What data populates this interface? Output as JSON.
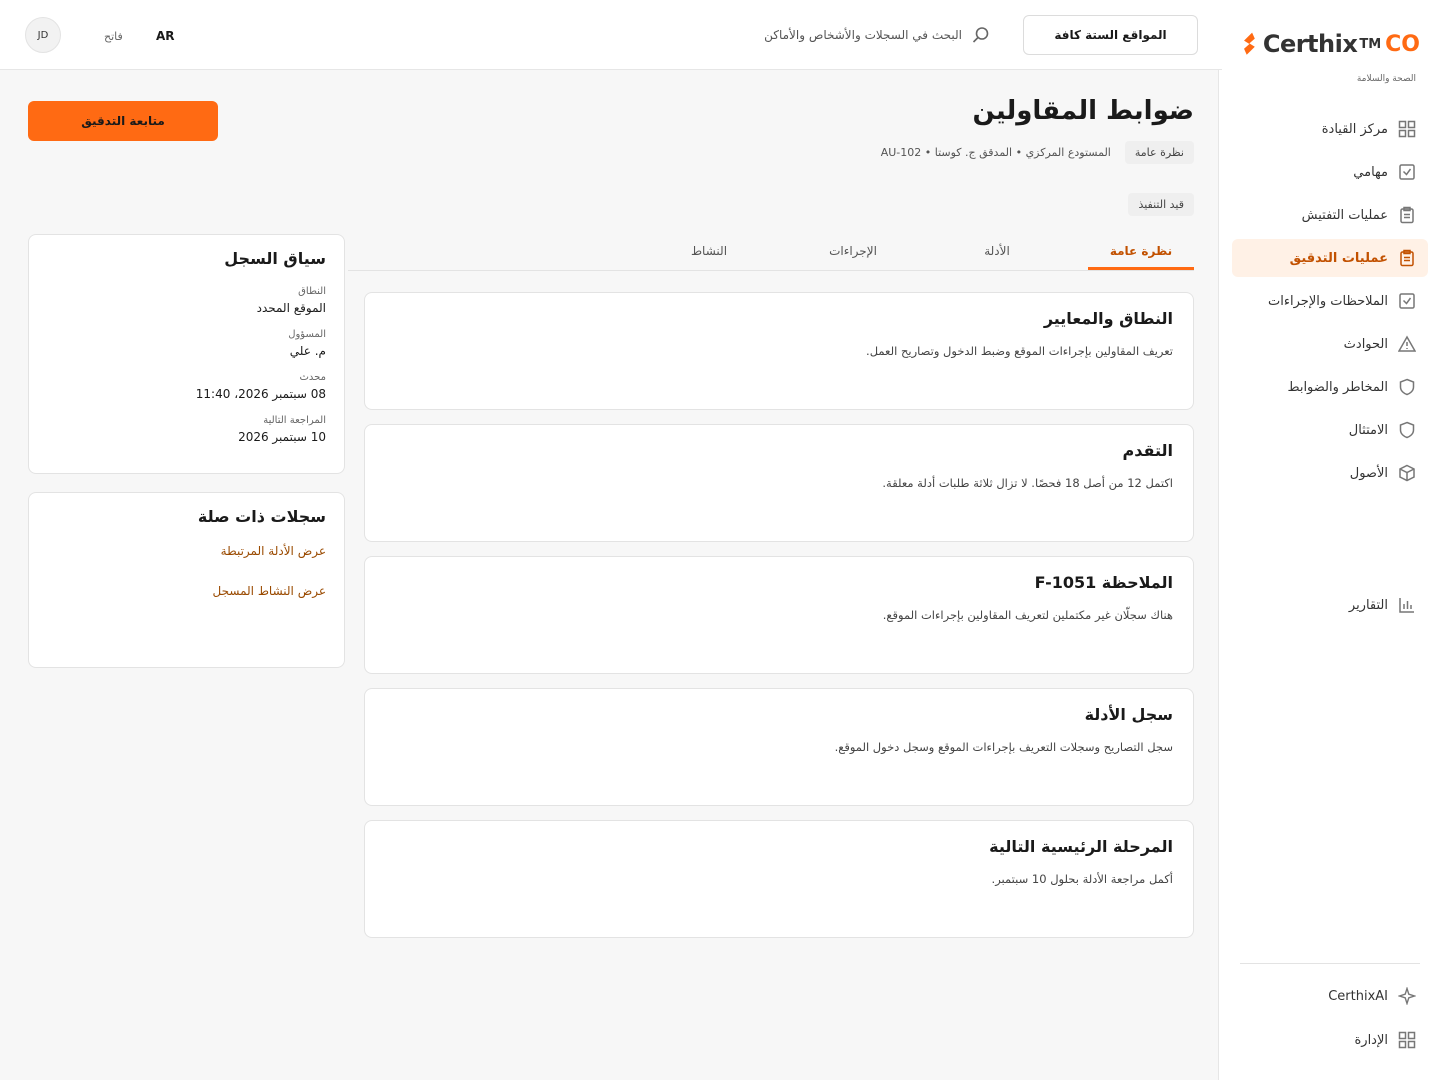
{
  "brand": {
    "name": "Certhix",
    "tm": "TM",
    "co": "CO",
    "tagline": "الصحة والسلامة",
    "accent": "#ff6a13"
  },
  "sidebar": {
    "items": [
      {
        "label": "مركز القيادة",
        "icon": "grid-icon"
      },
      {
        "label": "مهامي",
        "icon": "checkbox-icon"
      },
      {
        "label": "عمليات التفتيش",
        "icon": "clipboard-icon"
      },
      {
        "label": "عمليات التدقيق",
        "icon": "clipboard-icon",
        "active": true
      },
      {
        "label": "الملاحظات والإجراءات",
        "icon": "checkbox-icon"
      },
      {
        "label": "الحوادث",
        "icon": "warning-icon"
      },
      {
        "label": "المخاطر والضوابط",
        "icon": "shield-icon"
      },
      {
        "label": "الامتثال",
        "icon": "shield-icon"
      },
      {
        "label": "الأصول",
        "icon": "cube-icon"
      }
    ],
    "reports": {
      "label": "التقارير",
      "icon": "bar-chart-icon"
    },
    "bottom": [
      {
        "label": "CerthixAI",
        "icon": "sparkle-icon"
      },
      {
        "label": "الإدارة",
        "icon": "grid-icon"
      }
    ]
  },
  "topbar": {
    "sites_label": "المواقع الستة كافة",
    "search_placeholder": "البحث في السجلات والأشخاص والأماكن",
    "lang": "AR",
    "theme": "فاتح",
    "avatar": "JD"
  },
  "page": {
    "title": "ضوابط المقاولين",
    "overview_chip": "نظرة عامة",
    "meta": "المستودع المركزي • المدقق ج. كوستا • AU-102",
    "status": "قيد التنفيذ",
    "continue_label": "متابعة التدقيق"
  },
  "tabs": [
    {
      "label": "نظرة عامة",
      "active": true
    },
    {
      "label": "الأدلة"
    },
    {
      "label": "الإجراءات"
    },
    {
      "label": "النشاط"
    }
  ],
  "cards": [
    {
      "title": "النطاق والمعايير",
      "body": "تعريف المقاولين بإجراءات الموقع وضبط الدخول وتصاريح العمل."
    },
    {
      "title": "التقدم",
      "body": "اكتمل 12 من أصل 18 فحصًا. لا تزال ثلاثة طلبات أدلة معلقة."
    },
    {
      "title": "الملاحظة F-1051",
      "body": "هناك سجلّان غير مكتملين لتعريف المقاولين بإجراءات الموقع."
    },
    {
      "title": "سجل الأدلة",
      "body": "سجل التصاريح وسجلات التعريف بإجراءات الموقع وسجل دخول الموقع."
    },
    {
      "title": "المرحلة الرئيسية التالية",
      "body": "أكمل مراجعة الأدلة بحلول 10 سبتمبر."
    }
  ],
  "context": {
    "title": "سياق السجل",
    "fields": [
      {
        "label": "النطاق",
        "value": "الموقع المحدد"
      },
      {
        "label": "المسؤول",
        "value": "م. علي"
      },
      {
        "label": "محدث",
        "value": "08 سبتمبر 2026، 11:40"
      },
      {
        "label": "المراجعة التالية",
        "value": "10 سبتمبر 2026"
      }
    ]
  },
  "related": {
    "title": "سجلات ذات صلة",
    "links": [
      "عرض الأدلة المرتبطة",
      "عرض النشاط المسجل"
    ]
  }
}
